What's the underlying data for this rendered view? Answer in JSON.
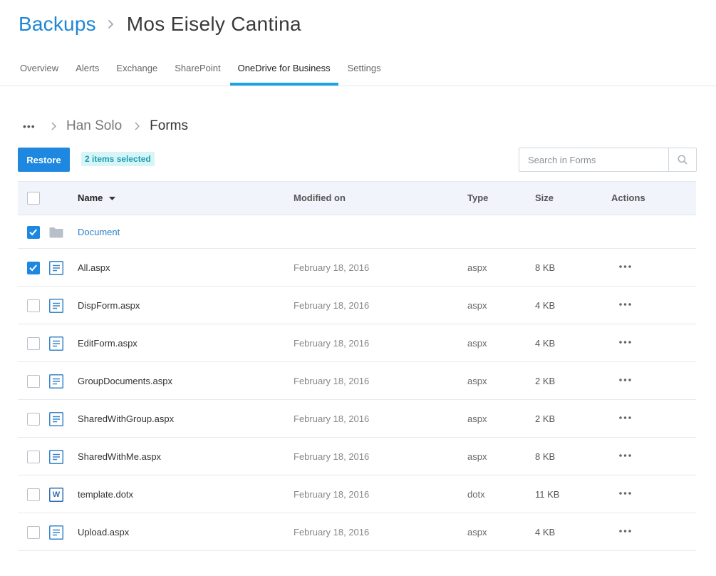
{
  "header": {
    "root": "Backups",
    "current": "Mos Eisely Cantina"
  },
  "tabs": [
    {
      "label": "Overview"
    },
    {
      "label": "Alerts"
    },
    {
      "label": "Exchange"
    },
    {
      "label": "SharePoint"
    },
    {
      "label": "OneDrive for Business",
      "active": true
    },
    {
      "label": "Settings"
    }
  ],
  "path": {
    "more": "•••",
    "parent": "Han Solo",
    "current": "Forms"
  },
  "toolbar": {
    "restore_label": "Restore",
    "selected_text": "2 items selected",
    "search_placeholder": "Search in Forms",
    "search_value": ""
  },
  "table": {
    "columns": {
      "name": "Name",
      "modified": "Modified on",
      "type": "Type",
      "size": "Size",
      "actions": "Actions"
    },
    "rows": [
      {
        "name": "Document",
        "modified": "",
        "type": "",
        "size": "",
        "icon": "folder-icon",
        "checked": true,
        "folder": true
      },
      {
        "name": "All.aspx",
        "modified": "February 18, 2016",
        "type": "aspx",
        "size": "8 KB",
        "icon": "document-icon",
        "checked": true
      },
      {
        "name": "DispForm.aspx",
        "modified": "February 18, 2016",
        "type": "aspx",
        "size": "4 KB",
        "icon": "document-icon",
        "checked": false
      },
      {
        "name": "EditForm.aspx",
        "modified": "February 18, 2016",
        "type": "aspx",
        "size": "4 KB",
        "icon": "document-icon",
        "checked": false
      },
      {
        "name": "GroupDocuments.aspx",
        "modified": "February 18, 2016",
        "type": "aspx",
        "size": "2 KB",
        "icon": "document-icon",
        "checked": false
      },
      {
        "name": "SharedWithGroup.aspx",
        "modified": "February 18, 2016",
        "type": "aspx",
        "size": "2 KB",
        "icon": "document-icon",
        "checked": false
      },
      {
        "name": "SharedWithMe.aspx",
        "modified": "February 18, 2016",
        "type": "aspx",
        "size": "8 KB",
        "icon": "document-icon",
        "checked": false
      },
      {
        "name": "template.dotx",
        "modified": "February 18, 2016",
        "type": "dotx",
        "size": "11 KB",
        "icon": "word-icon",
        "icon_letter": "W",
        "checked": false
      },
      {
        "name": "Upload.aspx",
        "modified": "February 18, 2016",
        "type": "aspx",
        "size": "4 KB",
        "icon": "document-icon",
        "checked": false
      }
    ]
  },
  "colors": {
    "accent": "#1e88e0",
    "tab_indicator": "#1aa3e8",
    "badge_bg": "#d7f4f7",
    "badge_text": "#1aa0b0"
  }
}
